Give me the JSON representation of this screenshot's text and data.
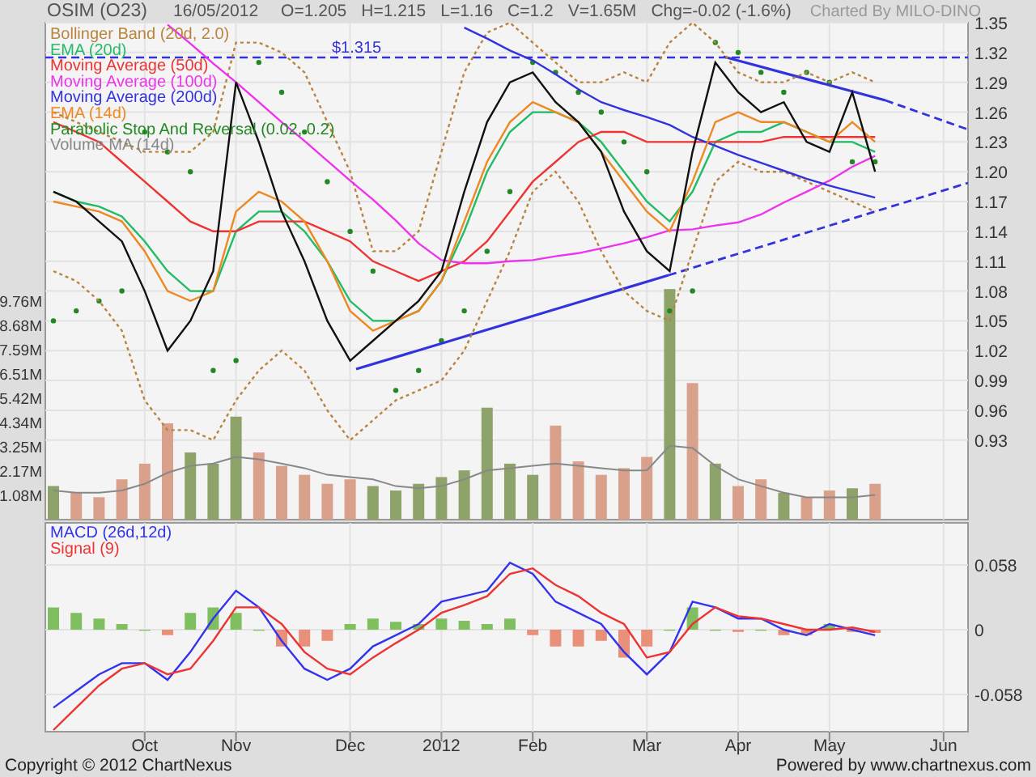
{
  "header": {
    "symbol": "OSIM (O23)",
    "date": "16/05/2012",
    "quote": [
      "O=1.205",
      "H=1.215",
      "L=1.16",
      "C=1.2",
      "V=1.65M",
      "Chg=-0.02 (-1.6%)"
    ],
    "credit": "Charted By MILO-DINO"
  },
  "price_panel": {
    "legend": [
      {
        "label": "Bollinger Band (20d, 2.0)",
        "color": "#b8843e"
      },
      {
        "label": "EMA (20d)",
        "color": "#22bb66"
      },
      {
        "label": "Moving Average (50d)",
        "color": "#ee3333"
      },
      {
        "label": "Moving Average (100d)",
        "color": "#ee33ee"
      },
      {
        "label": "Moving Average (200d)",
        "color": "#3333dd"
      },
      {
        "label": "EMA (14d)",
        "color": "#ee8822"
      },
      {
        "label": "Parabolic Stop And Reversal (0.02, 0.2)",
        "color": "#228822"
      },
      {
        "label": "Volume MA (14d)",
        "color": "#888888"
      }
    ],
    "chart_data": {
      "type": "line",
      "categories": [
        null,
        null,
        null,
        null,
        null,
        null,
        null,
        null,
        null,
        null,
        null,
        null,
        null,
        null,
        null,
        null,
        null,
        null,
        null,
        null,
        null,
        null,
        null,
        null,
        null,
        null,
        null,
        null,
        null,
        null,
        null,
        null,
        null,
        null,
        null,
        null,
        null
      ],
      "ylim": [
        0.85,
        1.35
      ],
      "yticks": [
        {
          "value": 1.35,
          "label": "1.35"
        },
        {
          "value": 1.32,
          "label": "1.32"
        },
        {
          "value": 1.29,
          "label": "1.29"
        },
        {
          "value": 1.26,
          "label": "1.26"
        },
        {
          "value": 1.23,
          "label": "1.23"
        },
        {
          "value": 1.2,
          "label": "1.20"
        },
        {
          "value": 1.17,
          "label": "1.17"
        },
        {
          "value": 1.14,
          "label": "1.14"
        },
        {
          "value": 1.11,
          "label": "1.11"
        },
        {
          "value": 1.08,
          "label": "1.08"
        },
        {
          "value": 1.05,
          "label": "1.05"
        },
        {
          "value": 1.02,
          "label": "1.02"
        },
        {
          "value": 0.99,
          "label": "0.99"
        },
        {
          "value": 0.96,
          "label": "0.96"
        },
        {
          "value": 0.93,
          "label": "0.93"
        }
      ],
      "ref_lines": [
        {
          "axis": "y",
          "value": 1.315,
          "label": "$1.315"
        }
      ],
      "series": [
        {
          "color": "#b8843e",
          "line_style": "dashed",
          "values": [
            1.26,
            1.25,
            1.24,
            1.23,
            1.22,
            1.22,
            1.22,
            1.24,
            1.33,
            1.33,
            1.32,
            1.3,
            1.25,
            1.2,
            1.12,
            1.12,
            1.14,
            1.22,
            1.3,
            1.34,
            1.35,
            1.33,
            1.31,
            1.29,
            1.29,
            1.3,
            1.29,
            1.33,
            1.35,
            1.33,
            1.3,
            1.29,
            1.29,
            1.3,
            1.29,
            1.3,
            1.29
          ]
        },
        {
          "color": "#b8843e",
          "line_style": "dashed",
          "values": [
            1.1,
            1.09,
            1.07,
            1.04,
            0.97,
            0.94,
            0.94,
            0.93,
            0.97,
            1.0,
            1.02,
            1.0,
            0.96,
            0.93,
            0.95,
            0.97,
            0.98,
            0.99,
            1.02,
            1.07,
            1.12,
            1.18,
            1.2,
            1.17,
            1.12,
            1.08,
            1.06,
            1.05,
            1.12,
            1.19,
            1.21,
            1.2,
            1.2,
            1.19,
            1.18,
            1.17,
            1.16
          ]
        },
        {
          "color": "#22bb66",
          "values": [
            1.18,
            1.17,
            1.165,
            1.155,
            1.13,
            1.1,
            1.08,
            1.08,
            1.14,
            1.16,
            1.16,
            1.14,
            1.11,
            1.07,
            1.05,
            1.05,
            1.06,
            1.09,
            1.14,
            1.2,
            1.24,
            1.26,
            1.26,
            1.25,
            1.23,
            1.2,
            1.17,
            1.15,
            1.18,
            1.23,
            1.24,
            1.24,
            1.25,
            1.24,
            1.23,
            1.23,
            1.22
          ]
        },
        {
          "color": "#ee3333",
          "values": [
            1.25,
            1.24,
            1.23,
            1.21,
            1.19,
            1.17,
            1.15,
            1.14,
            1.14,
            1.15,
            1.15,
            1.15,
            1.14,
            1.13,
            1.11,
            1.1,
            1.09,
            1.1,
            1.11,
            1.13,
            1.16,
            1.19,
            1.21,
            1.23,
            1.24,
            1.24,
            1.23,
            1.23,
            1.23,
            1.23,
            1.23,
            1.23,
            1.235,
            1.235,
            1.235,
            1.235,
            1.235
          ]
        },
        {
          "color": "#ee33ee",
          "values": [
            null,
            null,
            null,
            null,
            null,
            1.348,
            1.329,
            1.309,
            1.29,
            1.27,
            1.25,
            1.231,
            1.211,
            1.191,
            1.172,
            1.151,
            1.128,
            1.111,
            1.108,
            1.108,
            1.11,
            1.111,
            1.115,
            1.118,
            1.123,
            1.128,
            1.134,
            1.141,
            1.142,
            1.146,
            1.149,
            1.157,
            1.169,
            1.18,
            1.191,
            1.205,
            1.216
          ]
        },
        {
          "color": "#3333dd",
          "values": [
            null,
            null,
            null,
            null,
            null,
            null,
            null,
            null,
            null,
            null,
            null,
            null,
            null,
            null,
            null,
            null,
            null,
            null,
            1.345,
            1.334,
            1.322,
            1.312,
            1.298,
            1.283,
            1.27,
            1.262,
            1.255,
            1.247,
            1.235,
            1.226,
            1.217,
            1.209,
            1.201,
            1.193,
            1.186,
            1.18,
            1.174
          ]
        },
        {
          "color": "#ee8822",
          "values": [
            1.17,
            1.165,
            1.16,
            1.15,
            1.12,
            1.08,
            1.07,
            1.08,
            1.16,
            1.18,
            1.17,
            1.15,
            1.11,
            1.06,
            1.04,
            1.05,
            1.06,
            1.09,
            1.15,
            1.21,
            1.25,
            1.27,
            1.26,
            1.25,
            1.22,
            1.19,
            1.16,
            1.14,
            1.19,
            1.25,
            1.26,
            1.25,
            1.25,
            1.24,
            1.23,
            1.25,
            1.23
          ]
        },
        {
          "color": "#111111",
          "values": [
            1.18,
            1.17,
            1.15,
            1.13,
            1.08,
            1.02,
            1.05,
            1.1,
            1.29,
            1.23,
            1.16,
            1.11,
            1.05,
            1.01,
            1.03,
            1.05,
            1.07,
            1.1,
            1.18,
            1.25,
            1.29,
            1.3,
            1.27,
            1.25,
            1.22,
            1.16,
            1.12,
            1.1,
            1.22,
            1.31,
            1.28,
            1.26,
            1.27,
            1.23,
            1.22,
            1.28,
            1.2
          ]
        }
      ]
    }
  },
  "volume_panel": {
    "chart_data": {
      "type": "bar",
      "stacked": true,
      "categories": [
        null,
        null,
        null,
        null,
        null,
        null,
        null,
        null,
        null,
        null,
        null,
        null,
        null,
        null,
        null,
        null,
        null,
        null,
        null,
        null,
        null,
        null,
        null,
        null,
        null,
        null,
        null,
        null,
        null,
        null,
        null,
        null,
        null,
        null,
        null,
        null,
        null
      ],
      "ylim": [
        0,
        22.2
      ],
      "yticks": [
        {
          "value": 1.085,
          "label": "1.08M"
        },
        {
          "value": 2.17,
          "label": "2.17M"
        },
        {
          "value": 3.255,
          "label": "3.25M"
        },
        {
          "value": 4.34,
          "label": "4.34M"
        },
        {
          "value": 5.425,
          "label": "5.42M"
        },
        {
          "value": 6.51,
          "label": "6.51M"
        },
        {
          "value": 7.595,
          "label": "7.59M"
        },
        {
          "value": 8.68,
          "label": "8.68M"
        },
        {
          "value": 9.765,
          "label": "9.76M"
        }
      ],
      "series": [
        {
          "color": "#8ea36a",
          "values": [
            1.5,
            0,
            0,
            0,
            0,
            0,
            3.0,
            2.5,
            4.6,
            0,
            0,
            0,
            0,
            0,
            1.5,
            1.3,
            1.6,
            1.9,
            2.2,
            5.0,
            2.5,
            2.0,
            0,
            0,
            0,
            0,
            0,
            10.3,
            0,
            2.5,
            0,
            0,
            1.2,
            0,
            0,
            1.4,
            0
          ]
        },
        {
          "color": "#d9a08c",
          "values": [
            0,
            1.2,
            1.0,
            1.8,
            2.5,
            4.3,
            0,
            0,
            0,
            3.0,
            2.4,
            2.0,
            1.6,
            1.8,
            0,
            0,
            0,
            0,
            0,
            0,
            0,
            0,
            4.2,
            2.6,
            2.0,
            2.3,
            2.8,
            0,
            6.1,
            0,
            1.5,
            1.8,
            0,
            1.0,
            1.3,
            0,
            1.6
          ]
        },
        {
          "type": "line",
          "color": "#888888",
          "values": [
            1.3,
            1.2,
            1.2,
            1.3,
            1.6,
            2.1,
            2.4,
            2.5,
            2.8,
            2.7,
            2.5,
            2.3,
            2.0,
            1.9,
            1.8,
            1.5,
            1.4,
            1.5,
            1.8,
            2.2,
            2.3,
            2.4,
            2.5,
            2.4,
            2.3,
            2.2,
            2.2,
            3.3,
            3.2,
            2.4,
            1.8,
            1.5,
            1.2,
            1.0,
            1.0,
            1.0,
            1.1
          ]
        }
      ]
    }
  },
  "macd_panel": {
    "chart_data": {
      "type": "line",
      "categories": [
        null,
        null,
        null,
        null,
        "Oct",
        null,
        null,
        null,
        "Nov",
        null,
        null,
        null,
        null,
        "Dec",
        null,
        null,
        null,
        "2012",
        null,
        null,
        null,
        "Feb",
        null,
        null,
        null,
        null,
        "Mar",
        null,
        null,
        null,
        "Apr",
        null,
        null,
        null,
        "May",
        null,
        null,
        null,
        null,
        "Jun"
      ],
      "ylim": [
        -0.0914,
        0.0957
      ],
      "yticks": [
        {
          "value": 0.058,
          "label": "0.058"
        },
        {
          "value": 0,
          "label": "0"
        },
        {
          "value": -0.058,
          "label": "-0.058"
        }
      ],
      "series": [
        {
          "name": "MACD (26d,12d)",
          "color": "#3333ee",
          "values": [
            -0.07,
            -0.055,
            -0.04,
            -0.03,
            -0.03,
            -0.045,
            -0.02,
            0.01,
            0.035,
            0.02,
            -0.01,
            -0.035,
            -0.045,
            -0.035,
            -0.015,
            -0.005,
            0.005,
            0.025,
            0.03,
            0.035,
            0.06,
            0.05,
            0.025,
            0.015,
            0.005,
            -0.02,
            -0.04,
            -0.02,
            0.025,
            0.02,
            0.01,
            0.01,
            0.0,
            -0.005,
            0.005,
            0.0,
            -0.005,
            null,
            null,
            null
          ]
        },
        {
          "name": "Signal (9)",
          "color": "#ee3333",
          "values": [
            -0.09,
            -0.07,
            -0.05,
            -0.035,
            -0.03,
            -0.04,
            -0.035,
            -0.01,
            0.02,
            0.02,
            0.005,
            -0.02,
            -0.035,
            -0.04,
            -0.025,
            -0.012,
            0.0,
            0.015,
            0.022,
            0.03,
            0.05,
            0.055,
            0.04,
            0.03,
            0.015,
            0.005,
            -0.025,
            -0.02,
            0.005,
            0.02,
            0.012,
            0.01,
            0.005,
            0.0,
            0.0,
            0.002,
            -0.002,
            null,
            null,
            null
          ]
        }
      ]
    }
  },
  "footer": {
    "copyright": "Copyright © 2012 ChartNexus",
    "powered": "Powered by www.chartnexus.com"
  }
}
